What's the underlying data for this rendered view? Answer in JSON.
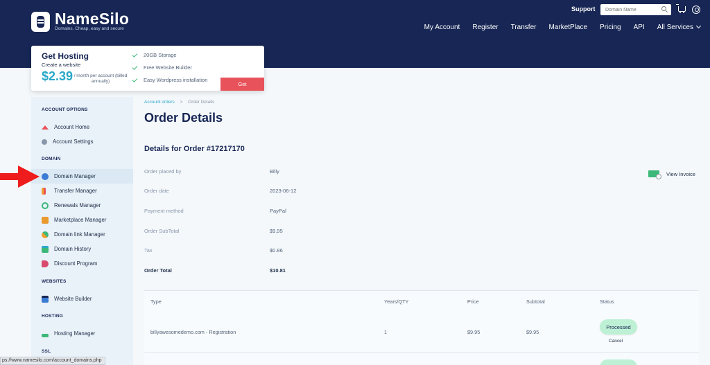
{
  "header": {
    "brand": "NameSilo",
    "tagline": "Domains. Cheap, easy and secure",
    "support": "Support",
    "search_placeholder": "Domain Name",
    "nav": [
      "My Account",
      "Register",
      "Transfer",
      "MarketPlace",
      "Pricing",
      "API",
      "All Services"
    ]
  },
  "promo": {
    "title": "Get Hosting",
    "subtitle": "Create a website",
    "price": "$2.39",
    "per": "/ month per account (billed annually)",
    "features": [
      "20GB Storage",
      "Free Website Builder",
      "Easy Wordpress installation"
    ],
    "button": "Get"
  },
  "sidebar": {
    "sections": {
      "account": "ACCOUNT OPTIONS",
      "domain": "DOMAIN",
      "websites": "WEBSITES",
      "hosting": "HOSTING",
      "ssl": "SSL"
    },
    "account_items": [
      {
        "label": "Account Home",
        "icon": "home-icon"
      },
      {
        "label": "Account Settings",
        "icon": "gear-icon"
      }
    ],
    "domain_items": [
      {
        "label": "Domain Manager",
        "icon": "globe-icon"
      },
      {
        "label": "Transfer Manager",
        "icon": "transfer-icon"
      },
      {
        "label": "Renewals Manager",
        "icon": "renew-icon"
      },
      {
        "label": "Marketplace Manager",
        "icon": "cart-icon"
      },
      {
        "label": "Domain link Manager",
        "icon": "link-icon"
      },
      {
        "label": "Domain History",
        "icon": "calendar-icon"
      },
      {
        "label": "Discount Program",
        "icon": "tag-icon"
      }
    ],
    "websites_items": [
      {
        "label": "Website Builder",
        "icon": "builder-icon"
      }
    ],
    "hosting_items": [
      {
        "label": "Hosting Manager",
        "icon": "server-icon"
      }
    ],
    "active": "Domain Manager"
  },
  "breadcrumb": {
    "parent": "Account orders",
    "separator": ">",
    "current": "Order Details"
  },
  "page_title": "Order Details",
  "order": {
    "heading": "Details for Order #17217170",
    "rows": [
      {
        "label": "Order placed by",
        "value": "Billy"
      },
      {
        "label": "Order date",
        "value": "2023-06-12"
      },
      {
        "label": "Payment method",
        "value": "PayPal"
      },
      {
        "label": "Order SubTotal",
        "value": "$9.95"
      },
      {
        "label": "Tax",
        "value": "$0.86"
      },
      {
        "label": "Order Total",
        "value": "$10.81"
      }
    ],
    "view_invoice": "View Invoice"
  },
  "table": {
    "headers": [
      "Type",
      "Years/QTY",
      "Price",
      "Subtotal",
      "Status"
    ],
    "rows": [
      {
        "type": "billyawesomedemo.com - Registration",
        "qty": "1",
        "price": "$9.95",
        "subtotal": "$9.95",
        "status": "Processed",
        "action": "Cancel"
      }
    ],
    "next_row_status": "Processed"
  },
  "status_url": "ps://www.namesilo.com/account_domains.php",
  "colors": {
    "navy": "#172654",
    "accent": "#2aa8c9",
    "get_button": "#e8525a",
    "processed": "#bdf0d5",
    "arrow": "#ee1c1c"
  }
}
